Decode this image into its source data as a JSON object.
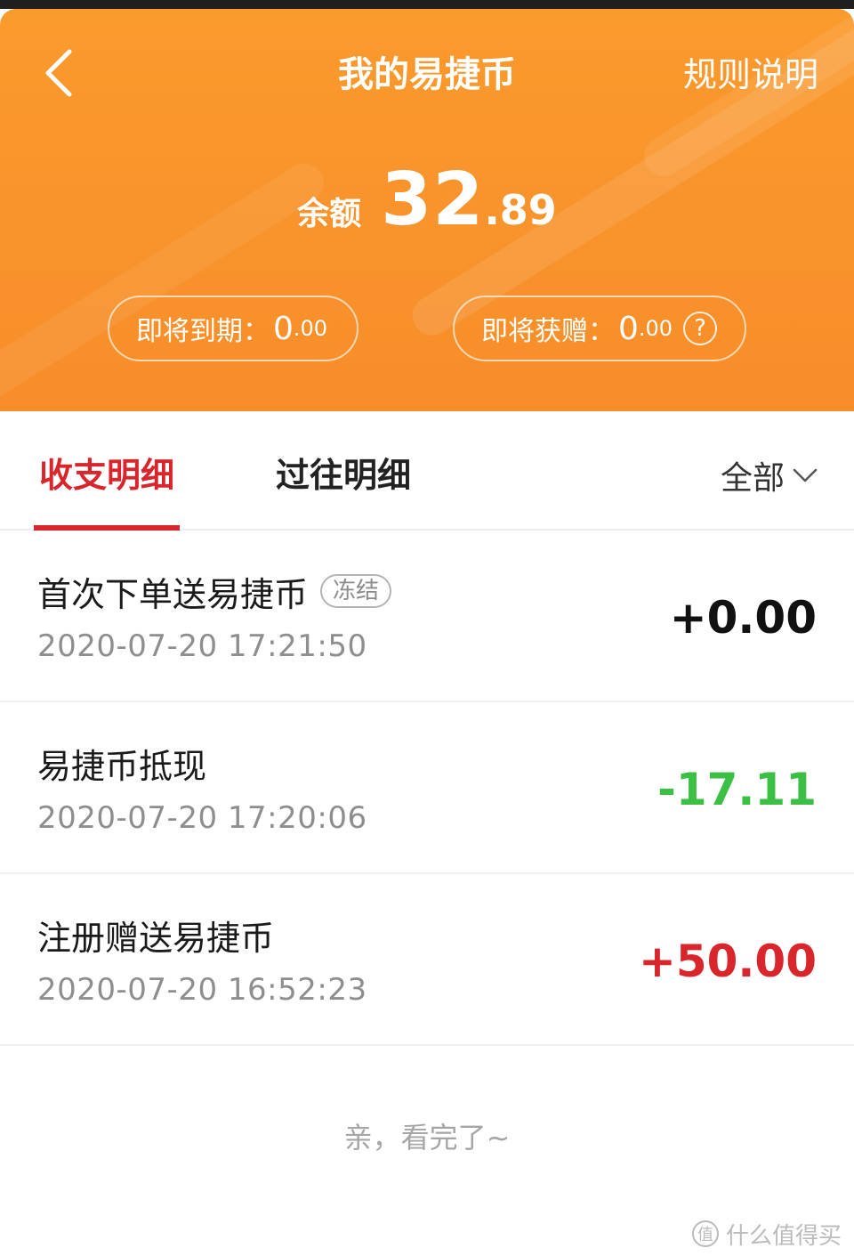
{
  "header": {
    "title": "我的易捷币",
    "rules_label": "规则说明",
    "back_icon": "chevron-left-icon",
    "bg_color": "#f7922b"
  },
  "balance": {
    "label": "余额",
    "integer_part": "32",
    "decimal_part": ".89"
  },
  "pills": {
    "expiring": {
      "label": "即将到期：",
      "integer_part": "0",
      "decimal_part": ".00"
    },
    "gifted": {
      "label": "即将获赠：",
      "integer_part": "0",
      "decimal_part": ".00",
      "help_glyph": "?"
    }
  },
  "tabs": {
    "items": [
      {
        "label": "收支明细",
        "active": true
      },
      {
        "label": "过往明细",
        "active": false
      }
    ],
    "filter_label": "全部",
    "accent_color": "#d8262c"
  },
  "records": [
    {
      "title": "首次下单送易捷币",
      "tag": "冻结",
      "time": "2020-07-20 17:21:50",
      "amount": "+0.00"
    },
    {
      "title": "易捷币抵现",
      "tag": "",
      "time": "2020-07-20 17:20:06",
      "amount": "-17.11"
    },
    {
      "title": "注册赠送易捷币",
      "tag": "",
      "time": "2020-07-20 16:52:23",
      "amount": "+50.00"
    }
  ],
  "colors": {
    "amount_neutral": "#111111",
    "amount_negative": "#3bbf45",
    "amount_positive": "#d8262c"
  },
  "footer": {
    "end_note": "亲，看完了~",
    "watermark": "什么值得买",
    "watermark_glyph": "值"
  }
}
